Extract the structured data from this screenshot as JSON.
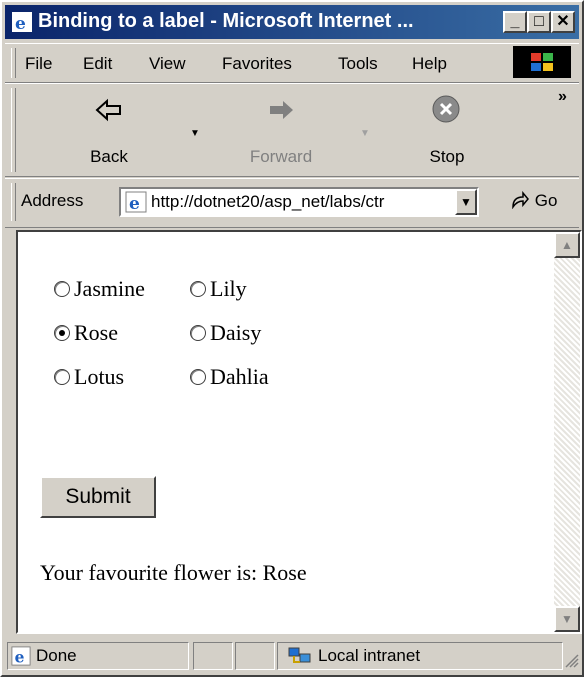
{
  "window": {
    "title": "Binding to a label - Microsoft Internet ...",
    "min_label": "_",
    "max_label": "□",
    "close_label": "✕"
  },
  "menu": [
    "File",
    "Edit",
    "View",
    "Favorites",
    "Tools",
    "Help"
  ],
  "toolbar": {
    "back_label": "Back",
    "forward_label": "Forward",
    "stop_label": "Stop",
    "more_label": "»"
  },
  "address": {
    "label": "Address",
    "url": "http://dotnet20/asp_net/labs/ctr",
    "go_label": "Go"
  },
  "form": {
    "flowers": [
      {
        "label": "Jasmine",
        "checked": false
      },
      {
        "label": "Lily",
        "checked": false
      },
      {
        "label": "Rose",
        "checked": true
      },
      {
        "label": "Daisy",
        "checked": false
      },
      {
        "label": "Lotus",
        "checked": false
      },
      {
        "label": "Dahlia",
        "checked": false
      }
    ],
    "submit_label": "Submit",
    "result_text": "Your favourite flower is: Rose"
  },
  "status": {
    "text": "Done",
    "zone": "Local intranet"
  },
  "icons": [
    "ie-page-icon",
    "back-arrow-icon",
    "forward-arrow-icon",
    "stop-icon",
    "go-arrow-icon",
    "intranet-icon",
    "windows-logo-icon"
  ]
}
